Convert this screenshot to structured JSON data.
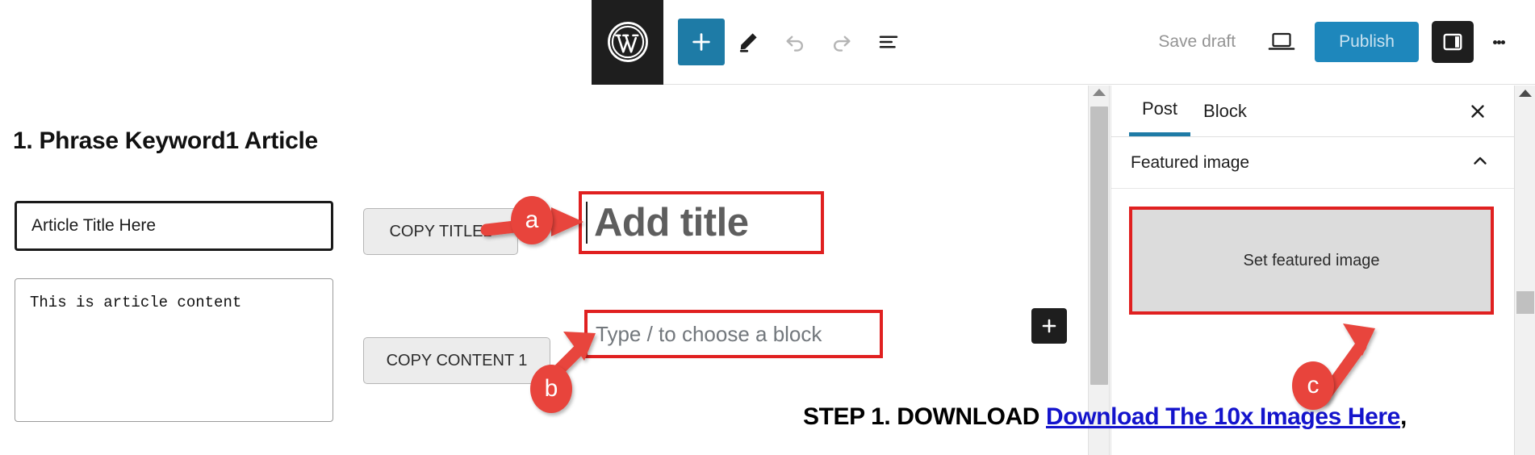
{
  "toolbar": {
    "logo_icon": "wordpress-logo-icon",
    "add_block_icon": "plus-icon",
    "edit_tool_icon": "pencil-icon",
    "undo_icon": "undo-arrow-icon",
    "redo_icon": "redo-arrow-icon",
    "list_view_icon": "document-outline-icon",
    "save_draft_label": "Save draft",
    "preview_icon": "laptop-preview-icon",
    "publish_label": "Publish",
    "sidebar_toggle_icon": "settings-panel-icon",
    "options_icon": "kebab-menu-icon",
    "accent_blue": "#1e7ba6",
    "publish_blue": "#1e87bc",
    "logo_black": "#1e1e1e"
  },
  "left_panel": {
    "heading": "1. Phrase Keyword1 Article",
    "title_input_value": "Article Title Here",
    "content_textarea_value": "This is article content",
    "copy_title_label": "COPY TITLE1",
    "copy_content_label": "COPY CONTENT 1"
  },
  "editor": {
    "add_title_placeholder": "Add title",
    "block_placeholder": "Type / to choose a block",
    "inline_adder_icon": "plus-icon",
    "highlight_color": "#e02020"
  },
  "sidebar": {
    "tabs": [
      {
        "label": "Post",
        "active": true
      },
      {
        "label": "Block",
        "active": false
      }
    ],
    "close_icon": "close-x-icon",
    "panel": {
      "title": "Featured image",
      "chevron_icon": "chevron-up-icon",
      "set_featured_label": "Set featured image"
    }
  },
  "callouts": [
    {
      "id": "a",
      "label": "a"
    },
    {
      "id": "b",
      "label": "b"
    },
    {
      "id": "c",
      "label": "c"
    }
  ],
  "footer": {
    "step_prefix": "STEP 1. DOWNLOAD ",
    "link_text": "Download The 10x Images Here",
    "trailing": ",",
    "link_color": "#1414cc"
  },
  "scrollbars": {
    "editor_up_icon": "scroll-up-arrow-icon",
    "page_up_icon": "scroll-up-arrow-icon"
  }
}
